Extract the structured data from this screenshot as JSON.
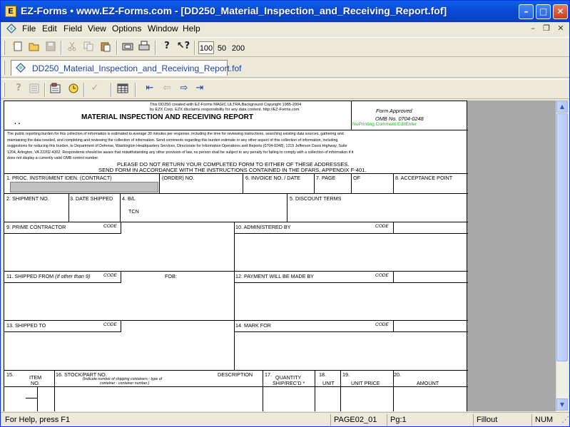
{
  "window": {
    "title": "EZ-Forms  •  www.EZ-Forms.com - [DD250_Material_Inspection_and_Receiving_Report.fof]",
    "app_icon_text": "E",
    "minimize": "–",
    "maximize": "□",
    "close": "✕"
  },
  "menu": {
    "items": [
      "File",
      "Edit",
      "Field",
      "View",
      "Options",
      "Window",
      "Help"
    ],
    "mdi_min": "–",
    "mdi_restore": "❐",
    "mdi_close": "✕"
  },
  "toolbar1": {
    "icons": [
      "new-icon",
      "open-icon",
      "save-icon",
      "cut-icon",
      "copy-icon",
      "paste-icon",
      "fax-icon",
      "print-icon",
      "help-icon",
      "context-help-icon"
    ],
    "zoom": [
      "100",
      "50",
      "200"
    ]
  },
  "doc_tab": {
    "label": "DD250_Material_Inspection_and_Receiving_Report.fof"
  },
  "toolbar2": {
    "icons": [
      "field-help-icon",
      "list-icon",
      "calculator-icon",
      "clock-icon",
      "check-icon",
      "table-icon",
      "first-page-icon",
      "prev-page-icon",
      "next-page-icon",
      "last-page-icon"
    ]
  },
  "form": {
    "header": {
      "copyright_line1": "This DD250 created with EZ-Forms MAGIC.ULTRA.Background Copyright 1985-2004",
      "copyright_line2": "by EZX Corp.  EZX disclaims responsibility for any data content. http://EZ-Forms.com",
      "title": "MATERIAL INSPECTION AND RECEIVING REPORT",
      "form_approved": "Form Approved",
      "omb": "OMB No. 0704-0248",
      "no_printing": "NoPrinting.Comment.EditEnter",
      "dots": ". ."
    },
    "burden": [
      "The public reporting burden for this collection of information is estimated to average 30 minutes per response, including the time for reviewing instructions, searching existing data sources, gathering and",
      "maintaining the data needed, and completing and reviewing the collection of information. Send comments regarding this burden estimate or any other aspect of this collection of information, including",
      "suggestions for reducing this burden, to Department of Defense, Washington Headquarters Services, Directorate for Information Operations and Reports (0704-0248), 1215 Jefferson Davis Highway, Suite",
      "1204, Arlington, VA 22202-4302. Respondents should be aware that notwithstanding any other provision of law, no person shall be subject to any penalty for failing to comply with a collection of information if it",
      "does not display a currently valid OMB control number."
    ],
    "instruction1": "PLEASE DO NOT RETURN YOUR COMPLETED FORM TO EITHER OF THESE ADDRESSES.",
    "instruction2": "SEND FORM IN ACCORDANCE WITH THE INSTRUCTIONS CONTAINED IN THE DFARS, APPENDIX F-401.",
    "row1": {
      "proc": "1. PROC. INSTRUMENT IDEN. (CONTRACT)",
      "order": "(ORDER) NO.",
      "invoice": "6. INVOICE NO. / DATE",
      "page": "7. PAGE",
      "of": "OF",
      "acceptance": "8. ACCEPTANCE POINT"
    },
    "row2": {
      "shipment": "2. SHIPMENT NO.",
      "date_shipped": "3. DATE SHIPPED",
      "bl": "4. B/L",
      "tcn": "TCN",
      "discount": "5. DISCOUNT TERMS"
    },
    "row3": {
      "prime": "9. PRIME CONTRACTOR",
      "code": "CODE",
      "administered": "10. ADMINISTERED BY",
      "code2": "CODE"
    },
    "row4": {
      "shipped_from": "11. SHIPPED FROM",
      "shipped_from_note": "(If other than 9)",
      "code": "CODE",
      "fob": "FOB:",
      "payment": "12. PAYMENT WILL BE MADE BY",
      "code2": "CODE"
    },
    "row5": {
      "shipped_to": "13. SHIPPED TO",
      "code": "CODE",
      "mark_for": "14. MARK FOR",
      "code2": "CODE"
    },
    "items": {
      "c15": "15.",
      "item_no_1": "ITEM",
      "item_no_2": "NO.",
      "c16": "16. STOCK/PART NO.",
      "description": "DESCRIPTION",
      "c16_note1": "(Indicate number of shipping containers - type of",
      "c16_note2": "container - container number.)",
      "c17": "17.",
      "qty1": "QUANTITY",
      "qty2": "SHIP/REC'D  *",
      "c18": "18.",
      "unit": "UNIT",
      "c19": "19.",
      "unit_price": "UNIT PRICE",
      "c20": "20.",
      "amount": "AMOUNT"
    }
  },
  "status": {
    "help": "For Help, press F1",
    "page_name": "PAGE02_01",
    "page_no": "Pg:1",
    "mode": "Fillout",
    "num": "NUM"
  }
}
